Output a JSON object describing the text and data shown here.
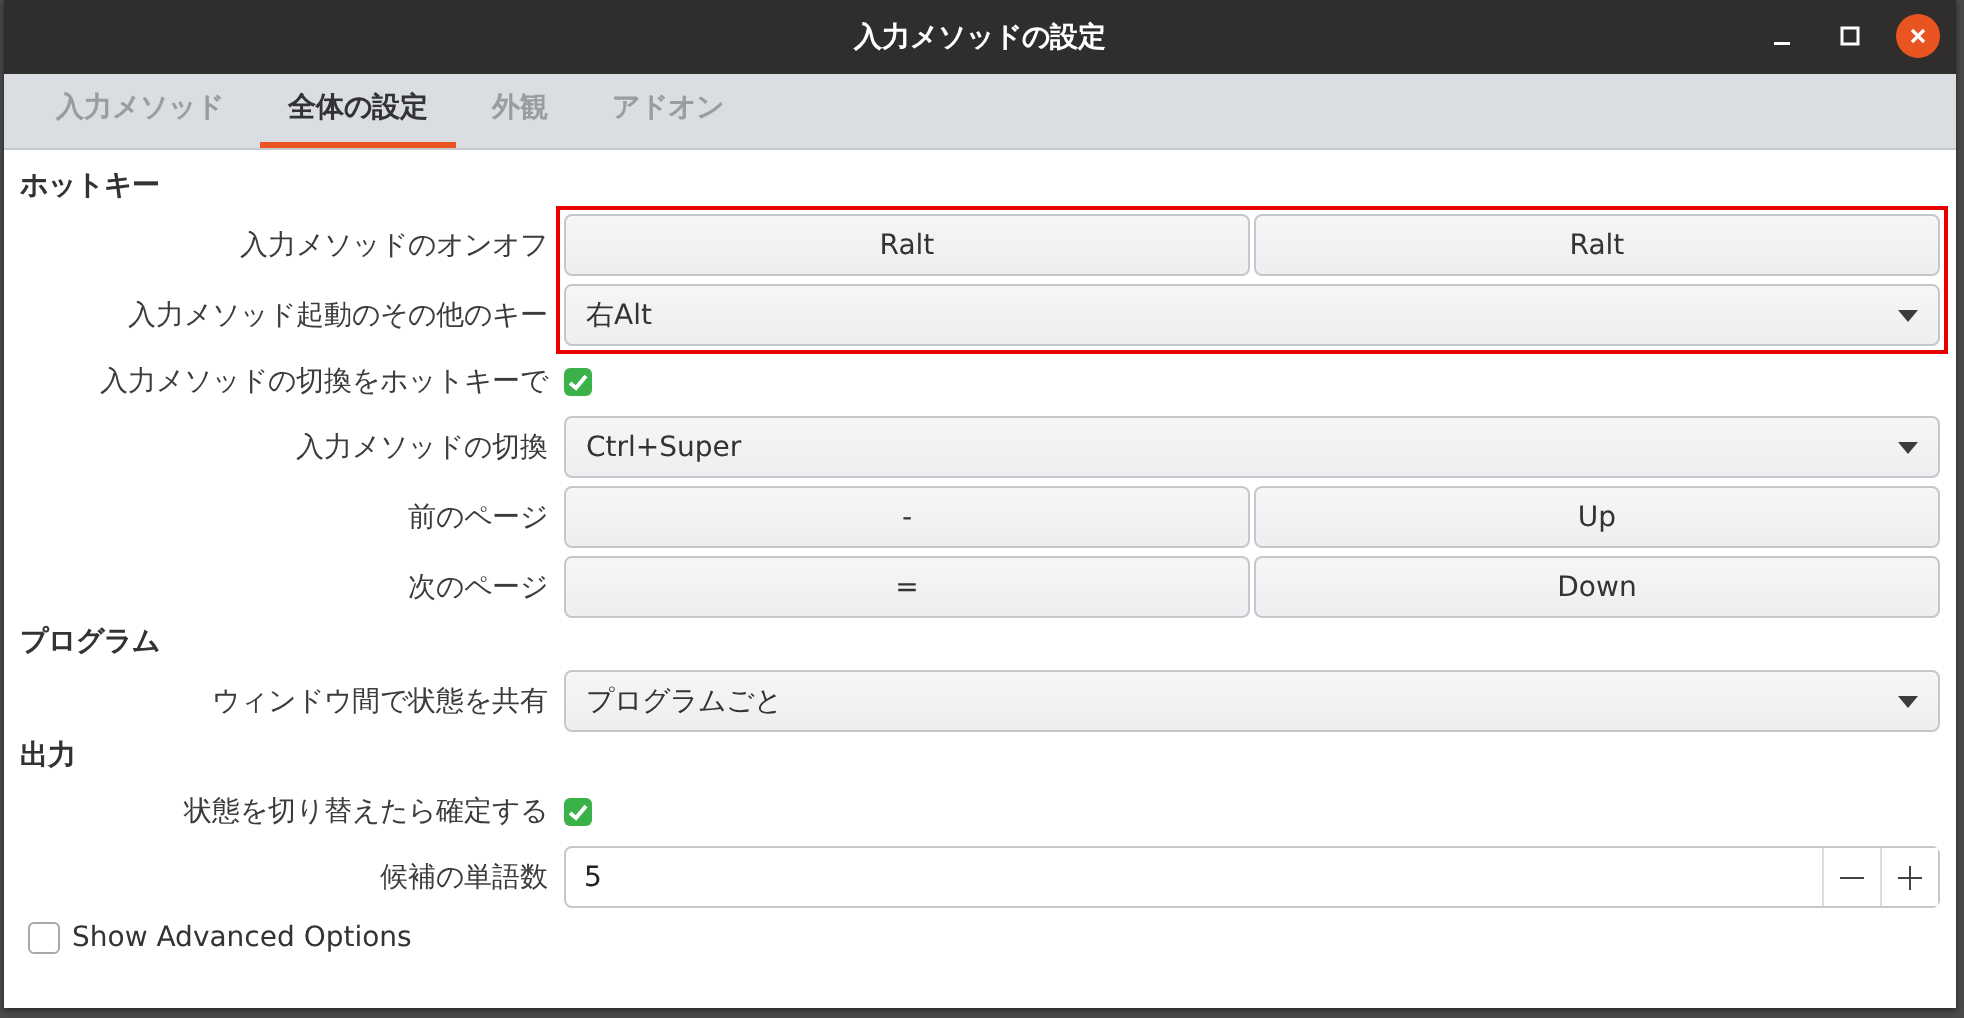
{
  "window": {
    "title": "入力メソッドの設定"
  },
  "tabs": [
    {
      "label": "入力メソッド",
      "selected": false
    },
    {
      "label": "全体の設定",
      "selected": true
    },
    {
      "label": "外観",
      "selected": false
    },
    {
      "label": "アドオン",
      "selected": false
    }
  ],
  "sections": [
    {
      "title": "ホットキー",
      "rows": [
        {
          "kind": "keys",
          "label": "入力メソッドのオンオフ",
          "keys": [
            "Ralt",
            "Ralt"
          ],
          "highlighted": true
        },
        {
          "kind": "combo",
          "label": "入力メソッド起動のその他のキー",
          "value": "右Alt",
          "highlighted": true
        },
        {
          "kind": "check",
          "label": "入力メソッドの切換をホットキーで",
          "checked": true
        },
        {
          "kind": "combo",
          "label": "入力メソッドの切換",
          "value": "Ctrl+Super"
        },
        {
          "kind": "keys",
          "label": "前のページ",
          "keys": [
            "-",
            "Up"
          ]
        },
        {
          "kind": "keys",
          "label": "次のページ",
          "keys": [
            "=",
            "Down"
          ]
        }
      ]
    },
    {
      "title": "プログラム",
      "rows": [
        {
          "kind": "combo",
          "label": "ウィンドウ間で状態を共有",
          "value": "プログラムごと"
        }
      ]
    },
    {
      "title": "出力",
      "rows": [
        {
          "kind": "check",
          "label": "状態を切り替えたら確定する",
          "checked": true
        },
        {
          "kind": "spin",
          "label": "候補の単語数",
          "value": "5"
        }
      ]
    }
  ],
  "advanced": {
    "label": "Show Advanced Options",
    "checked": false
  }
}
